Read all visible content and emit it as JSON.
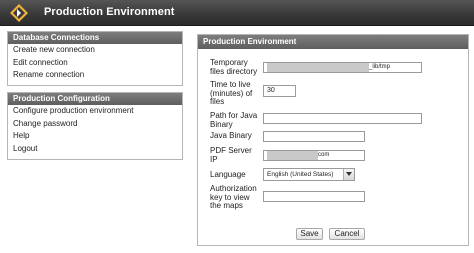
{
  "app": {
    "title": "Production Environment"
  },
  "sidebar": {
    "sections": [
      {
        "title": "Database Connections",
        "items": [
          "Create new connection",
          "Edit connection",
          "Rename connection"
        ]
      },
      {
        "title": "Production Configuration",
        "items": [
          "Configure production environment",
          "Change password",
          "Help",
          "Logout"
        ]
      }
    ]
  },
  "main": {
    "title": "Production Environment",
    "fields": {
      "temp_dir": {
        "label": "Temporary files directory",
        "value_suffix": "_lib/tmp"
      },
      "ttl": {
        "label": "Time to live (minutes) of files",
        "value": "30"
      },
      "java_path": {
        "label": "Path for Java Binary",
        "value": ""
      },
      "java_binary": {
        "label": "Java Binary",
        "value": ""
      },
      "pdf_server": {
        "label": "PDF Server IP",
        "value_suffix": "com"
      },
      "language": {
        "label": "Language",
        "value": "English (United States)"
      },
      "auth_key": {
        "label": "Authorization key to view the maps",
        "value": ""
      }
    },
    "buttons": {
      "save": "Save",
      "cancel": "Cancel"
    }
  },
  "icons": {
    "logo": "app-logo-icon",
    "dropdown": "chevron-down-icon"
  },
  "colors": {
    "titlebar": "#3a3a3a",
    "panel_header": "#6e6e6e",
    "logo_accent": "#f2b33d"
  }
}
